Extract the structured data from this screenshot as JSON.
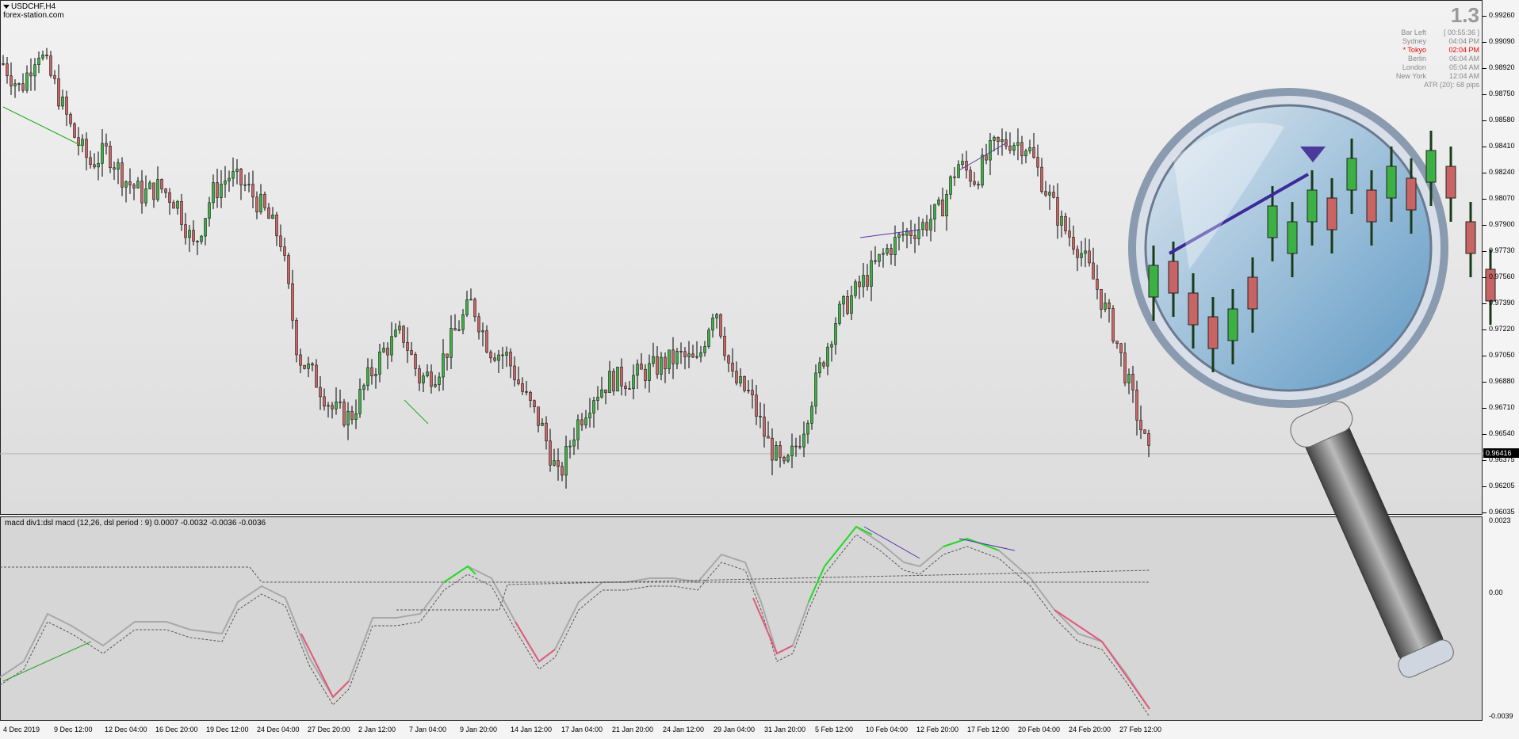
{
  "window": {
    "symbol_title": "USDCHF,H4",
    "watermark": "forex-station.com"
  },
  "info_panel": {
    "big_value": "1.3",
    "rows": [
      {
        "label": "Bar Left",
        "value": "[ 00:55:36 ]",
        "highlight": false
      },
      {
        "label": "Sydney",
        "value": "04:04 PM",
        "highlight": false
      },
      {
        "label": "* Tokyo",
        "value": "02:04 PM",
        "highlight": true
      },
      {
        "label": "Berlin",
        "value": "06:04 AM",
        "highlight": false
      },
      {
        "label": "London",
        "value": "05:04 AM",
        "highlight": false
      },
      {
        "label": "New York",
        "value": "12:04 AM",
        "highlight": false
      }
    ],
    "atr": "ATR (20): 68 pips"
  },
  "price_axis": {
    "labels": [
      "0.99260",
      "0.99090",
      "0.98920",
      "0.98750",
      "0.98580",
      "0.98410",
      "0.98240",
      "0.98070",
      "0.97900",
      "0.97730",
      "0.97560",
      "0.97390",
      "0.97220",
      "0.97050",
      "0.96880",
      "0.96710",
      "0.96540",
      "0.96375",
      "0.96205",
      "0.96035"
    ],
    "current_price": "0.96416"
  },
  "indicator": {
    "title": "macd div1:dsl macd (12,26, dsl period : 9) 0.0007 -0.0032 -0.0036 -0.0036",
    "axis_labels": [
      "0.0023",
      "0.00",
      "-0.0039"
    ]
  },
  "time_axis": {
    "labels": [
      "4 Dec 2019",
      "9 Dec 12:00",
      "12 Dec 04:00",
      "16 Dec 20:00",
      "19 Dec 12:00",
      "24 Dec 04:00",
      "27 Dec 20:00",
      "2 Jan 12:00",
      "7 Jan 04:00",
      "9 Jan 20:00",
      "14 Jan 12:00",
      "17 Jan 04:00",
      "21 Jan 20:00",
      "24 Jan 12:00",
      "29 Jan 04:00",
      "31 Jan 20:00",
      "5 Feb 12:00",
      "10 Feb 04:00",
      "12 Feb 20:00",
      "17 Feb 12:00",
      "20 Feb 04:00",
      "24 Feb 20:00",
      "27 Feb 12:00"
    ]
  },
  "colors": {
    "bull": "#3cb043",
    "bear": "#c86464",
    "macd_up": "#22dd22",
    "macd_down": "#e05a7a",
    "macd_flat": "#a8a8a8"
  },
  "chart_data": {
    "type": "candlestick",
    "series": [
      {
        "name": "USDCHF,H4",
        "close_path": [
          0.9895,
          0.9878,
          0.9905,
          0.988,
          0.985,
          0.983,
          0.9838,
          0.982,
          0.981,
          0.9815,
          0.9805,
          0.9775,
          0.981,
          0.9822,
          0.9815,
          0.98,
          0.978,
          0.9705,
          0.969,
          0.967,
          0.9665,
          0.969,
          0.971,
          0.972,
          0.969,
          0.9695,
          0.972,
          0.974,
          0.971,
          0.9705,
          0.968,
          0.966,
          0.9625,
          0.966,
          0.968,
          0.969,
          0.969,
          0.9695,
          0.97,
          0.9705,
          0.97,
          0.974,
          0.969,
          0.968,
          0.965,
          0.963,
          0.9655,
          0.9695,
          0.973,
          0.9745,
          0.976,
          0.9775,
          0.9785,
          0.979,
          0.98,
          0.983,
          0.982,
          0.984,
          0.9845,
          0.9842,
          0.9815,
          0.979,
          0.9775,
          0.975,
          0.972,
          0.968,
          0.964
        ]
      }
    ]
  }
}
